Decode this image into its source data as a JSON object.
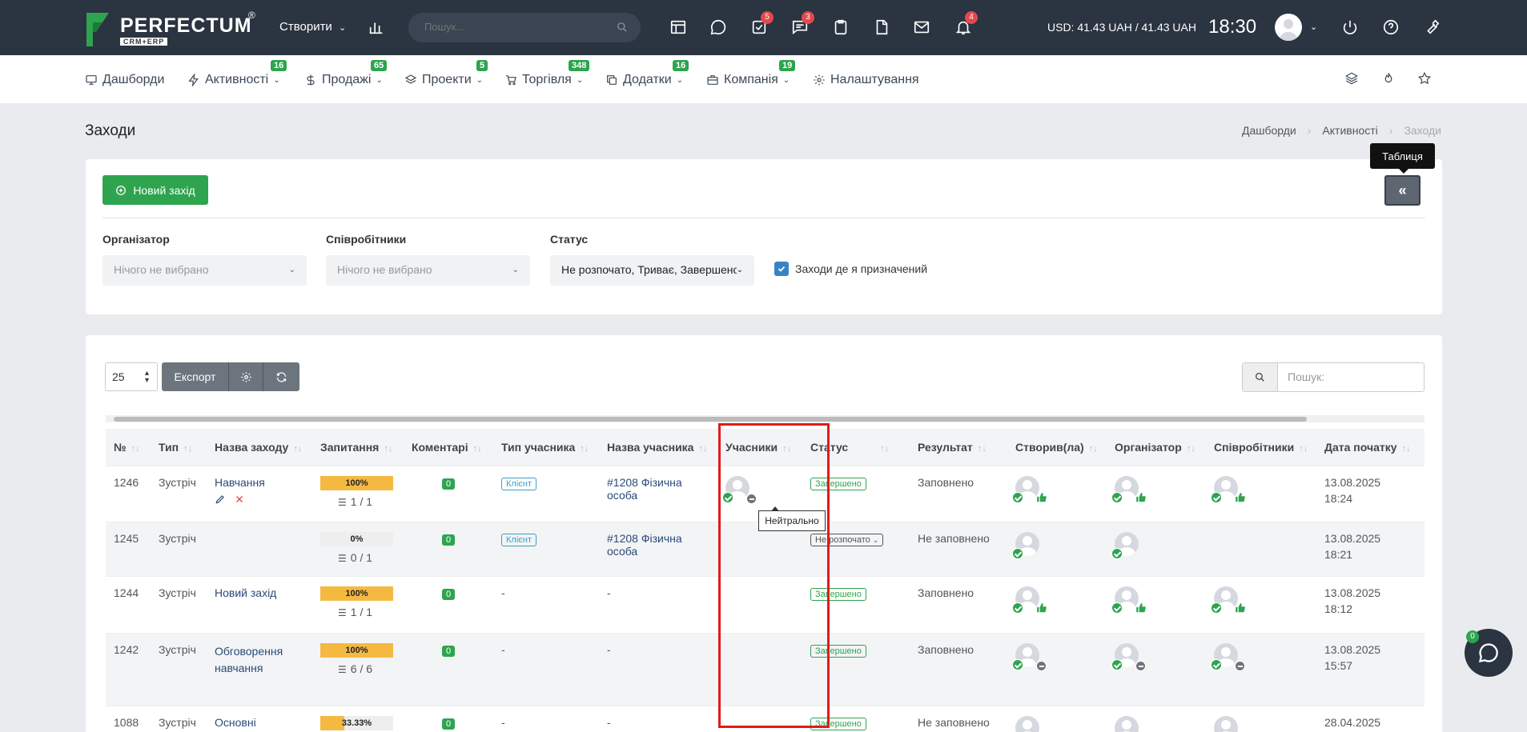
{
  "header": {
    "logo_word": "PERFECTUM",
    "logo_reg": "®",
    "logo_sub": "CRM+ERP",
    "create_label": "Створити",
    "search_placeholder": "Пошук...",
    "badges": {
      "tasks": "5",
      "chat": "3",
      "notifications": "4"
    },
    "currency": "USD: 41.43 UAH / 41.43 UAH",
    "time": "18:30"
  },
  "nav": {
    "items": [
      {
        "label": "Дашборди",
        "badge": ""
      },
      {
        "label": "Активності",
        "badge": "16"
      },
      {
        "label": "Продажі",
        "badge": "65"
      },
      {
        "label": "Проекти",
        "badge": "5"
      },
      {
        "label": "Торгівля",
        "badge": "348"
      },
      {
        "label": "Додатки",
        "badge": "16"
      },
      {
        "label": "Компанія",
        "badge": "19"
      },
      {
        "label": "Налаштування",
        "badge": ""
      }
    ]
  },
  "page": {
    "title": "Заходи",
    "breadcrumb": [
      "Дашборди",
      "Активності",
      "Заходи"
    ]
  },
  "filters": {
    "new_button": "Новий захід",
    "table_tooltip": "Таблиця",
    "collapse_label": "«",
    "organizer_label": "Організатор",
    "organizer_value": "Нічого не вибрано",
    "employees_label": "Співробітники",
    "employees_value": "Нічого не вибрано",
    "status_label": "Статус",
    "status_value": "Не розпочато, Триває, Завершено",
    "assigned_checkbox": "Заходи де я призначений"
  },
  "toolbar": {
    "per_page": "25",
    "export_label": "Експорт",
    "search_placeholder": "Пошук:"
  },
  "table": {
    "columns": [
      "№",
      "Тип",
      "Назва заходу",
      "Запитання",
      "Коментарі",
      "Тип учасника",
      "Назва учасника",
      "Учасники",
      "Статус",
      "Результат",
      "Створив(ла)",
      "Організатор",
      "Співробітники",
      "Дата початку"
    ],
    "rows": [
      {
        "id": "1246",
        "type": "Зустріч",
        "name": "Навчання",
        "progress_label": "100%",
        "progress": 100,
        "questions": "1 / 1",
        "comments": "0",
        "participant_type": "Клієнт",
        "participant_name": "#1208 Фізична особа",
        "status": "Завершено",
        "status_kind": "done",
        "result": "Заповнено",
        "date": "13.08.2025",
        "time": "18:24"
      },
      {
        "id": "1245",
        "type": "Зустріч",
        "name": "",
        "progress_label": "0%",
        "progress": 0,
        "questions": "0 / 1",
        "comments": "0",
        "participant_type": "Клієнт",
        "participant_name": "#1208 Фізична особа",
        "status": "Не розпочато",
        "status_kind": "notstarted",
        "result": "Не заповнено",
        "date": "13.08.2025",
        "time": "18:21"
      },
      {
        "id": "1244",
        "type": "Зустріч",
        "name": "Новий захід",
        "progress_label": "100%",
        "progress": 100,
        "questions": "1 / 1",
        "comments": "0",
        "participant_type": "-",
        "participant_name": "-",
        "status": "Завершено",
        "status_kind": "done",
        "result": "Заповнено",
        "date": "13.08.2025",
        "time": "18:12"
      },
      {
        "id": "1242",
        "type": "Зустріч",
        "name": "Обговорення навчання",
        "progress_label": "100%",
        "progress": 100,
        "questions": "6 / 6",
        "comments": "0",
        "participant_type": "-",
        "participant_name": "-",
        "status": "Завершено",
        "status_kind": "done",
        "result": "Заповнено",
        "date": "13.08.2025",
        "time": "15:57"
      },
      {
        "id": "1088",
        "type": "Зустріч",
        "name": "Основні",
        "progress_label": "33.33%",
        "progress": 33.33,
        "questions": "",
        "comments": "0",
        "participant_type": "-",
        "participant_name": "-",
        "status": "Завершено",
        "status_kind": "done",
        "result": "Не заповнено",
        "date": "28.04.2025",
        "time": ""
      }
    ]
  },
  "tooltip_neutral": "Нейтрально",
  "chat_badge": "0",
  "colors": {
    "topbar": "#2b3441",
    "accent_green": "#2ea44f",
    "highlight_red": "#e01b1b"
  }
}
